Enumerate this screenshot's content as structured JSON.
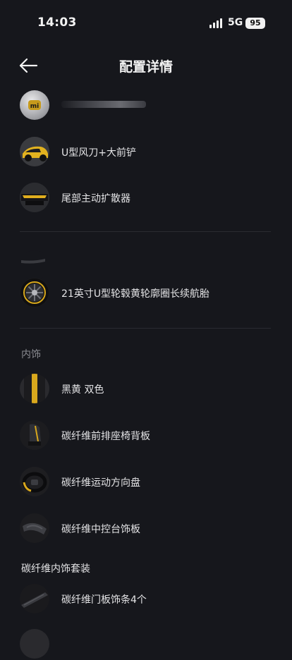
{
  "status_bar": {
    "time": "14:03",
    "network": "5G",
    "battery": "95"
  },
  "header": {
    "title": "配置详情"
  },
  "items": [
    {
      "label": "",
      "icon": "mi-logo-icon"
    },
    {
      "label": "U型风刀+大前铲",
      "icon": "front-blade-icon"
    },
    {
      "label": "尾部主动扩散器",
      "icon": "rear-diffuser-icon"
    },
    {
      "label": "",
      "icon": "carbon-strip-icon"
    },
    {
      "label": "21英寸U型轮毂黄轮廓圈长续航胎",
      "icon": "wheel-icon"
    }
  ],
  "interior": {
    "section_label": "内饰",
    "items": [
      {
        "label": "黑黄 双色",
        "icon": "color-swatch-icon"
      },
      {
        "label": "碳纤维前排座椅背板",
        "icon": "seat-back-icon"
      },
      {
        "label": "碳纤维运动方向盘",
        "icon": "steering-wheel-icon"
      },
      {
        "label": "碳纤维中控台饰板",
        "icon": "console-trim-icon"
      }
    ]
  },
  "interior_kit": {
    "group_label": "碳纤维内饰套装",
    "items": [
      {
        "label": "碳纤维门板饰条4个",
        "icon": "door-trim-icon"
      }
    ]
  }
}
